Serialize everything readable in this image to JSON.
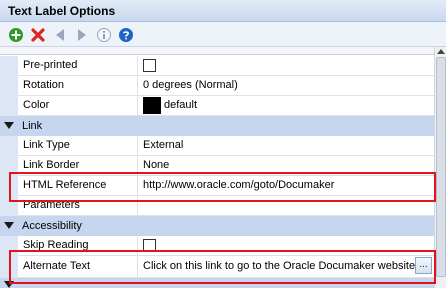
{
  "window": {
    "title": "Text Label Options"
  },
  "toolbar": {
    "buttons": [
      {
        "icon": "add-icon",
        "color": "#2e9a2e"
      },
      {
        "icon": "delete-icon",
        "color": "#d8281e"
      },
      {
        "icon": "arrow-left-icon",
        "color": "#9aa8bb"
      },
      {
        "icon": "arrow-right-icon",
        "color": "#9aa8bb"
      },
      {
        "icon": "info-icon",
        "color": "#9aa8bb"
      },
      {
        "icon": "help-icon",
        "color": "#1f64c4"
      }
    ]
  },
  "properties": {
    "preprinted": {
      "label": "Pre-printed",
      "checked": false
    },
    "rotation": {
      "label": "Rotation",
      "value": "0 degrees (Normal)"
    },
    "color": {
      "label": "Color",
      "value": "default",
      "swatch": "#000000"
    },
    "link_category": {
      "label": "Link"
    },
    "link_type": {
      "label": "Link Type",
      "value": "External"
    },
    "link_border": {
      "label": "Link Border",
      "value": "None"
    },
    "html_reference": {
      "label": "HTML Reference",
      "value": "http://www.oracle.com/goto/Documaker"
    },
    "parameters": {
      "label": "Parameters",
      "value": ""
    },
    "accessibility_category": {
      "label": "Accessibility"
    },
    "skip_reading": {
      "label": "Skip Reading",
      "checked": false
    },
    "alternate_text": {
      "label": "Alternate Text",
      "value": "Click on this link to go to the Oracle Documaker website.",
      "button_label": "..."
    }
  },
  "highlight_color": "#e0151c"
}
